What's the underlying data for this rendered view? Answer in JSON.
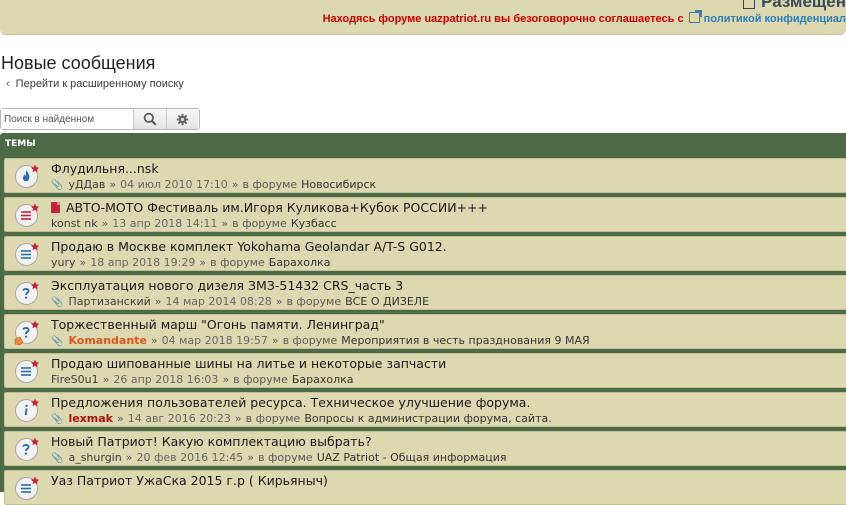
{
  "header": {
    "top_title": "Размещен",
    "notice_text": "Находясь форуме uazpatriot.ru вы безоговорочно соглашаетесь с",
    "notice_link": "политикой конфиденциал"
  },
  "page": {
    "title": "Новые сообщения",
    "advanced_search_link": "Перейти к расширенному поиску"
  },
  "search": {
    "placeholder": "Поиск в найденном",
    "search_icon": "search-icon",
    "settings_icon": "gear-icon"
  },
  "topics": {
    "header": "ТЕМЫ",
    "by_sep": "»",
    "in_forum_label": "в форуме",
    "items": [
      {
        "title": "Флудильня...nsk",
        "author": "уДДав",
        "date": "04 июл 2010 17:10",
        "forum": "Новосибирск",
        "icon": "fire-icon",
        "color": "#2c6db0",
        "attachment": true,
        "author_style": ""
      },
      {
        "title": "АВТО-МОТО Фестиваль им.Игоря Куликова+Кубок РОССИИ+++",
        "author": "konst nk",
        "date": "13 апр 2018 14:11",
        "forum": "Кузбасс",
        "icon": "lines-icon",
        "color": "#c9223a",
        "attachment": false,
        "doc": true,
        "author_style": ""
      },
      {
        "title": "Продаю в Москве комплект Yokohama Geolandar A/T-S G012.",
        "author": "yury",
        "date": "18 апр 2018 19:29",
        "forum": "Барахолка",
        "icon": "lines-icon",
        "color": "#2c6db0",
        "attachment": false,
        "author_style": ""
      },
      {
        "title": "Эксплуатация нового дизеля ЗМЗ-51432 CRS_часть 3",
        "author": "Партизанский",
        "date": "14 мар 2014 08:28",
        "forum": "ВСЕ О ДИЗЕЛЕ",
        "icon": "question-icon",
        "color": "#2c6db0",
        "attachment": true,
        "author_style": ""
      },
      {
        "title": "Торжественный марш \"Огонь памяти. Ленинград\"",
        "author": "Komandante",
        "date": "04 мар 2018 19:57",
        "forum": "Мероприятия в честь празднования 9 МАЯ",
        "icon": "question-icon",
        "color": "#2c6db0",
        "attachment": true,
        "author_style": "orange",
        "badge": true
      },
      {
        "title": "Продаю шипованные шины на литье и некоторые запчасти",
        "author": "FireS0u1",
        "date": "26 апр 2018 16:03",
        "forum": "Барахолка",
        "icon": "lines-icon",
        "color": "#2c6db0",
        "attachment": false,
        "author_style": ""
      },
      {
        "title": "Предложения пользователей ресурса. Техническое улучшение форума.",
        "author": "lexmak",
        "date": "14 авг 2016 20:23",
        "forum": "Вопросы к администрации форума, сайта.",
        "icon": "info-icon",
        "color": "#2c6db0",
        "attachment": true,
        "author_style": "darkred"
      },
      {
        "title": "Новый Патриот! Какую комплектацию выбрать?",
        "author": "a_shurgin",
        "date": "20 фев 2016 12:45",
        "forum": "UAZ Patriot - Общая информация",
        "icon": "question-icon",
        "color": "#2c6db0",
        "attachment": true,
        "author_style": ""
      },
      {
        "title": "Уаз Патриот УжаСка 2015 г.р ( Кирьяныч)",
        "author": "",
        "date": "",
        "forum": "",
        "icon": "lines-icon",
        "color": "#2c6db0",
        "attachment": false,
        "author_style": ""
      }
    ]
  }
}
